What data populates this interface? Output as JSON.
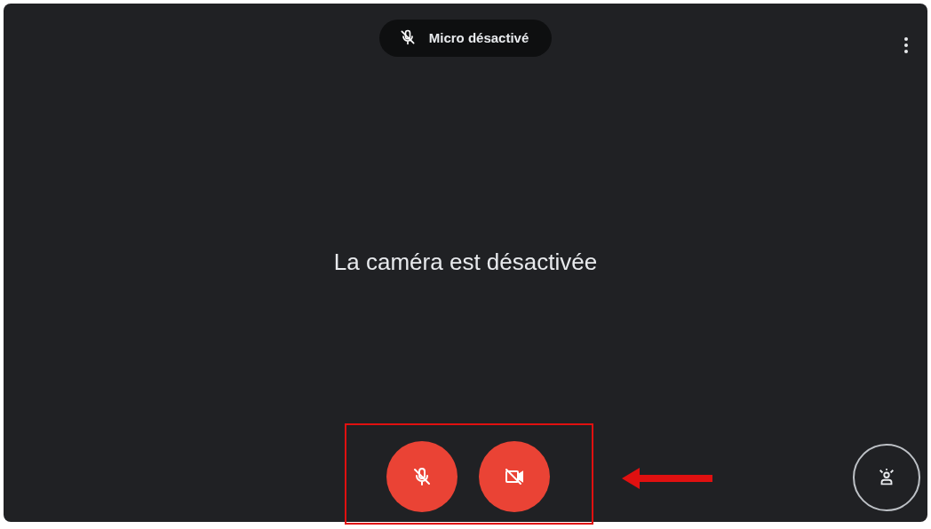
{
  "banner": {
    "label": "Micro désactivé"
  },
  "camera_message": "La caméra est désactivée",
  "controls": [
    {
      "kind": "mic",
      "on": false
    },
    {
      "kind": "camera",
      "on": false
    }
  ],
  "effects_button": {
    "kind": "effects"
  }
}
